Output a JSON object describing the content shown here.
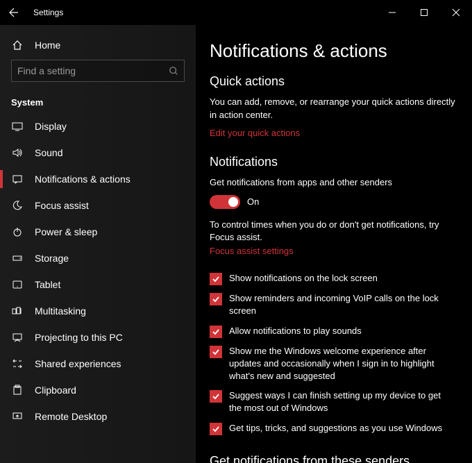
{
  "titlebar": {
    "title": "Settings"
  },
  "sidebar": {
    "home": "Home",
    "search_placeholder": "Find a setting",
    "section": "System",
    "items": [
      {
        "label": "Display"
      },
      {
        "label": "Sound"
      },
      {
        "label": "Notifications & actions"
      },
      {
        "label": "Focus assist"
      },
      {
        "label": "Power & sleep"
      },
      {
        "label": "Storage"
      },
      {
        "label": "Tablet"
      },
      {
        "label": "Multitasking"
      },
      {
        "label": "Projecting to this PC"
      },
      {
        "label": "Shared experiences"
      },
      {
        "label": "Clipboard"
      },
      {
        "label": "Remote Desktop"
      }
    ]
  },
  "content": {
    "heading": "Notifications & actions",
    "quick": {
      "title": "Quick actions",
      "desc": "You can add, remove, or rearrange your quick actions directly in action center.",
      "link": "Edit your quick actions"
    },
    "notifications": {
      "title": "Notifications",
      "toggle_desc": "Get notifications from apps and other senders",
      "toggle_state": "On",
      "focus_hint": "To control times when you do or don't get notifications, try Focus assist.",
      "focus_link": "Focus assist settings",
      "checks": [
        "Show notifications on the lock screen",
        "Show reminders and incoming VoIP calls on the lock screen",
        "Allow notifications to play sounds",
        "Show me the Windows welcome experience after updates and occasionally when I sign in to highlight what's new and suggested",
        "Suggest ways I can finish setting up my device to get the most out of Windows",
        "Get tips, tricks, and suggestions as you use Windows"
      ]
    },
    "senders_heading": "Get notifications from these senders"
  }
}
